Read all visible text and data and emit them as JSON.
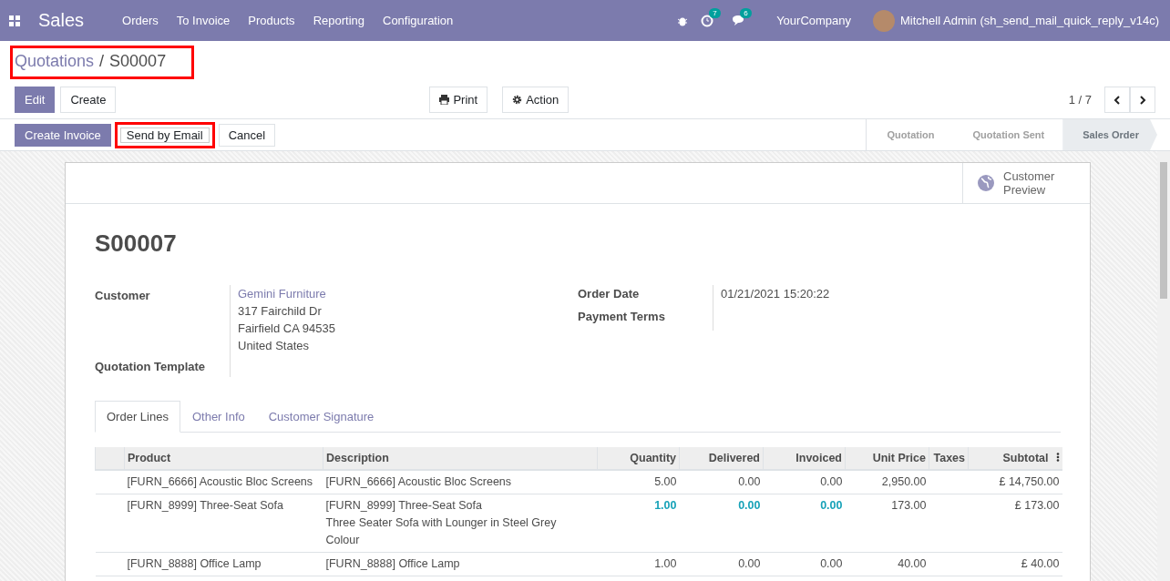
{
  "navbar": {
    "app_title": "Sales",
    "menu": [
      "Orders",
      "To Invoice",
      "Products",
      "Reporting",
      "Configuration"
    ],
    "activity_count": "7",
    "message_count": "6",
    "company": "YourCompany",
    "user": "Mitchell Admin (sh_send_mail_quick_reply_v14c)"
  },
  "breadcrumb": {
    "parent": "Quotations",
    "separator": "/",
    "current": "S00007",
    "highlighted": true
  },
  "control_panel": {
    "edit": "Edit",
    "create": "Create",
    "print": "Print",
    "action": "Action",
    "pager": "1 / 7"
  },
  "header_buttons": [
    {
      "label": "Create Invoice",
      "primary": true,
      "highlighted": false
    },
    {
      "label": "Send by Email",
      "primary": false,
      "highlighted": true
    },
    {
      "label": "Cancel",
      "primary": false,
      "highlighted": false
    }
  ],
  "stages": [
    {
      "label": "Quotation",
      "selected": false
    },
    {
      "label": "Quotation Sent",
      "selected": false
    },
    {
      "label": "Sales Order",
      "selected": true
    }
  ],
  "sheet": {
    "smart_button": "Customer\nPreview",
    "title": "S00007",
    "left_fields": [
      {
        "label": "Customer",
        "link": "Gemini Furniture",
        "lines": [
          "317 Fairchild Dr",
          "Fairfield CA 94535",
          "United States"
        ]
      },
      {
        "label": "Quotation Template"
      }
    ],
    "right_fields": [
      {
        "label": "Order Date",
        "value": "01/21/2021 15:20:22"
      },
      {
        "label": "Payment Terms"
      }
    ],
    "tabs": [
      {
        "label": "Order Lines",
        "selected": true
      },
      {
        "label": "Other Info",
        "selected": false
      },
      {
        "label": "Customer Signature",
        "selected": false
      }
    ],
    "table": {
      "columns": [
        "Product",
        "Description",
        "Quantity",
        "Delivered",
        "Invoiced",
        "Unit Price",
        "Taxes",
        "Subtotal"
      ],
      "rows": [
        {
          "product": "[FURN_6666] Acoustic Bloc Screens",
          "description": [
            "[FURN_6666] Acoustic Bloc Screens"
          ],
          "quantity": "5.00",
          "delivered": "0.00",
          "invoiced": "0.00",
          "unit_price": "2,950.00",
          "subtotal": "£ 14,750.00",
          "highlight": false
        },
        {
          "product": "[FURN_8999] Three-Seat Sofa",
          "description": [
            "[FURN_8999] Three-Seat Sofa",
            "Three Seater Sofa with Lounger in Steel Grey",
            "Colour"
          ],
          "quantity": "1.00",
          "delivered": "0.00",
          "invoiced": "0.00",
          "unit_price": "173.00",
          "subtotal": "£ 173.00",
          "highlight": true
        },
        {
          "product": "[FURN_8888] Office Lamp",
          "description": [
            "[FURN_8888] Office Lamp"
          ],
          "quantity": "1.00",
          "delivered": "0.00",
          "invoiced": "0.00",
          "unit_price": "40.00",
          "subtotal": "£ 40.00",
          "highlight": false
        }
      ]
    }
  }
}
